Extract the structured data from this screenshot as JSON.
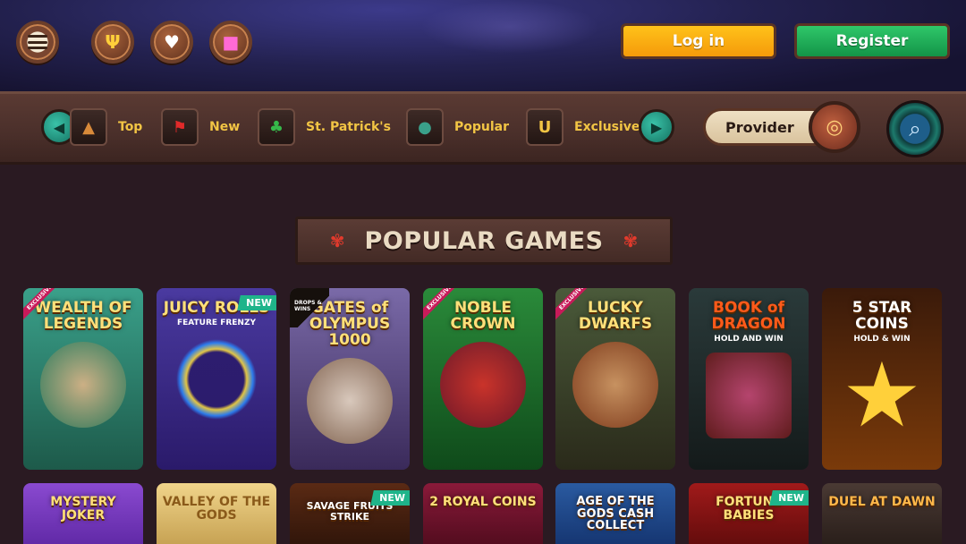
{
  "header": {
    "menu_icon": "hamburger-icon",
    "quick_icons": [
      "casino-trident-icon",
      "playing-cards-icon",
      "gift-icon"
    ],
    "login_label": "Log in",
    "register_label": "Register",
    "colors": {
      "login": "#f7a90e",
      "register": "#1fa855"
    }
  },
  "categories": [
    {
      "label": "Top",
      "icon": "pot-icon"
    },
    {
      "label": "New",
      "icon": "flag-icon"
    },
    {
      "label": "St. Patrick's",
      "icon": "leprechaun-hat-icon"
    },
    {
      "label": "Popular",
      "icon": "fire-icon"
    },
    {
      "label": "Exclusive",
      "icon": "horseshoe-icon"
    }
  ],
  "provider": {
    "label": "Provider",
    "icon": "slot-reel-icon"
  },
  "search": {
    "icon": "search-icon"
  },
  "section": {
    "title": "POPULAR GAMES"
  },
  "games_row1": [
    {
      "name": "WEALTH OF LEGENDS",
      "badge": "EXCLUSIVE",
      "bg": "#2c8a7a"
    },
    {
      "name": "JUICY ROLLS",
      "sub": "FEATURE FRENZY",
      "badge": "NEW",
      "bg": "#3a2a86"
    },
    {
      "name": "GATES of OLYMPUS 1000",
      "badge": "DROPS & WINS",
      "bg": "#5a4a8a"
    },
    {
      "name": "NOBLE CROWN",
      "badge": "EXCLUSIVE",
      "bg": "#1f6a34"
    },
    {
      "name": "LUCKY DWARFS",
      "badge": "EXCLUSIVE",
      "bg": "#3a4a34"
    },
    {
      "name": "BOOK of DRAGON",
      "sub": "HOLD AND WIN",
      "bg": "#1f2a2f"
    },
    {
      "name": "5 STAR COINS",
      "sub": "HOLD & WIN",
      "bg": "#3a1a0a"
    }
  ],
  "games_row2": [
    {
      "name": "MYSTERY JOKER",
      "bg": "#6a34b4"
    },
    {
      "name": "VALLEY OF THE GODS",
      "bg": "#d9b25a"
    },
    {
      "name": "SAVAGE FRUITS STRIKE",
      "badge": "NEW",
      "bg": "#4a2414"
    },
    {
      "name": "2 ROYAL COINS",
      "bg": "#7a1434"
    },
    {
      "name": "AGE OF THE GODS CASH COLLECT",
      "bg": "#1a4a8a"
    },
    {
      "name": "FORTUNE BABIES",
      "badge": "NEW",
      "bg": "#8a1414"
    },
    {
      "name": "DUEL AT DAWN",
      "bg": "#3a2a24"
    }
  ]
}
